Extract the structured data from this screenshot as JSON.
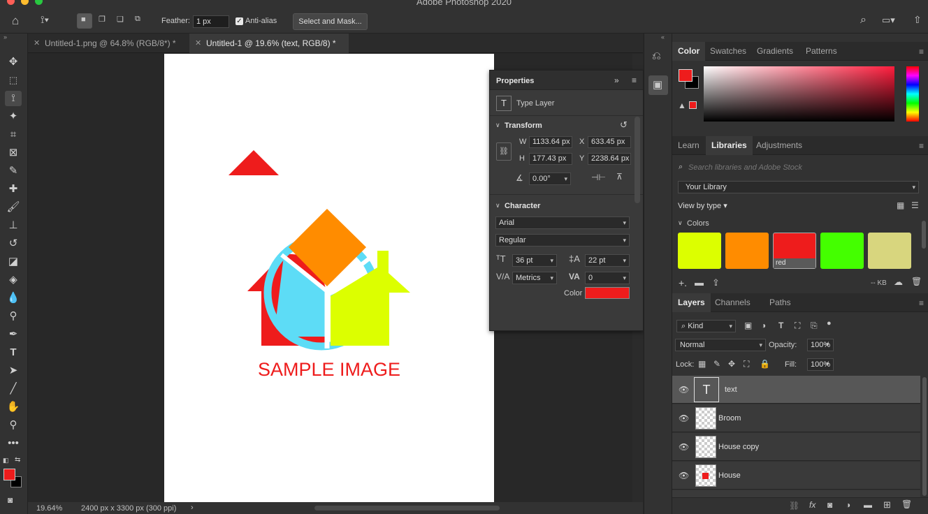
{
  "app": {
    "title": "Adobe Photoshop 2020"
  },
  "options": {
    "feather_label": "Feather:",
    "feather_value": "1 px",
    "antialias_label": "Anti-alias",
    "select_mask_label": "Select and Mask..."
  },
  "tabs": [
    {
      "label": "Untitled-1.png @ 64.8% (RGB/8*) *"
    },
    {
      "label": "Untitled-1 @ 19.6% (text, RGB/8) *"
    }
  ],
  "canvas": {
    "sample_text": "SAMPLE IMAGE"
  },
  "status": {
    "zoom": "19.64%",
    "doc_info": "2400 px x 3300 px (300 ppi)"
  },
  "properties": {
    "title": "Properties",
    "layer_type": "Type Layer",
    "transform_title": "Transform",
    "w_label": "W",
    "w_value": "1133.64 px",
    "x_label": "X",
    "x_value": "633.45 px",
    "h_label": "H",
    "h_value": "177.43 px",
    "y_label": "Y",
    "y_value": "2238.64 px",
    "angle_value": "0.00°",
    "character_title": "Character",
    "font_family": "Arial",
    "font_style": "Regular",
    "font_size": "36 pt",
    "leading": "22 pt",
    "kerning": "Metrics",
    "tracking": "0",
    "color_label": "Color",
    "color_hex": "#ee1c1c"
  },
  "color_panel": {
    "tabs": [
      "Color",
      "Swatches",
      "Gradients",
      "Patterns"
    ],
    "fg": "#ee1c1c",
    "bg": "#000000"
  },
  "libraries_panel": {
    "tabs": [
      "Learn",
      "Libraries",
      "Adjustments"
    ],
    "search_placeholder": "Search libraries and Adobe Stock",
    "library": "Your Library",
    "view_by": "View by type",
    "colors_section": "Colors",
    "swatches": [
      {
        "color": "#dcff00",
        "label": ""
      },
      {
        "color": "#ff8c00",
        "label": ""
      },
      {
        "color": "#ee1c1c",
        "label": "red"
      },
      {
        "color": "#44ff00",
        "label": ""
      },
      {
        "color": "#d8d67e",
        "label": ""
      }
    ],
    "storage": "-- KB"
  },
  "layers_panel": {
    "tabs": [
      "Layers",
      "Channels",
      "Paths"
    ],
    "filter_kind": "Kind",
    "blend_mode": "Normal",
    "opacity_label": "Opacity:",
    "opacity_value": "100%",
    "lock_label": "Lock:",
    "fill_label": "Fill:",
    "fill_value": "100%",
    "layers": [
      {
        "name": "text"
      },
      {
        "name": "Broom"
      },
      {
        "name": "House copy"
      },
      {
        "name": "House"
      }
    ]
  }
}
